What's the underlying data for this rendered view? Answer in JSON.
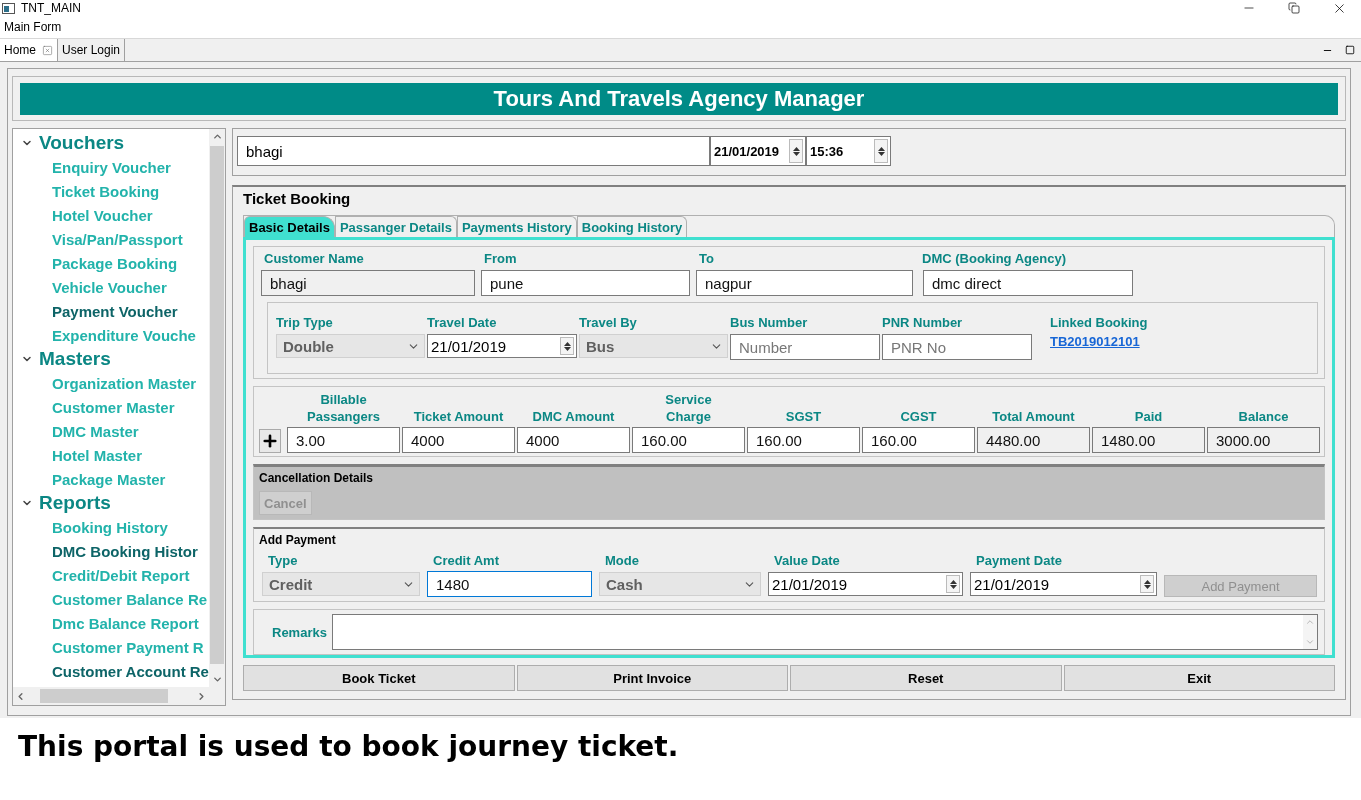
{
  "window": {
    "title": "TNT_MAIN"
  },
  "menu": [
    "Main Form"
  ],
  "doc_tabs": [
    {
      "label": "Home",
      "selected": true,
      "closable": true
    },
    {
      "label": "User Login",
      "selected": false,
      "closable": false
    }
  ],
  "header": {
    "title": "Tours And Travels Agency Manager"
  },
  "sidebar": {
    "groups": [
      {
        "label": "Vouchers",
        "expanded": true,
        "items": [
          {
            "label": "Enquiry Voucher",
            "highlighted": false
          },
          {
            "label": "Ticket Booking",
            "highlighted": false
          },
          {
            "label": "Hotel Voucher",
            "highlighted": false
          },
          {
            "label": "Visa/Pan/Passport",
            "highlighted": false
          },
          {
            "label": "Package Booking",
            "highlighted": false
          },
          {
            "label": "Vehicle Voucher",
            "highlighted": false
          },
          {
            "label": "Payment Voucher",
            "highlighted": true
          },
          {
            "label": "Expenditure Vouche",
            "highlighted": false
          }
        ]
      },
      {
        "label": "Masters",
        "expanded": true,
        "items": [
          {
            "label": "Organization Master",
            "highlighted": false
          },
          {
            "label": "Customer Master",
            "highlighted": false
          },
          {
            "label": "DMC Master",
            "highlighted": false
          },
          {
            "label": "Hotel Master",
            "highlighted": false
          },
          {
            "label": "Package Master",
            "highlighted": false
          }
        ]
      },
      {
        "label": "Reports",
        "expanded": true,
        "items": [
          {
            "label": "Booking History",
            "highlighted": false
          },
          {
            "label": "DMC Booking Histor",
            "highlighted": true
          },
          {
            "label": "Credit/Debit Report",
            "highlighted": false
          },
          {
            "label": "Customer Balance Re",
            "highlighted": false
          },
          {
            "label": "Dmc Balance Report",
            "highlighted": false
          },
          {
            "label": "Customer Payment R",
            "highlighted": false
          },
          {
            "label": "Customer Account Re",
            "highlighted": true
          }
        ]
      }
    ]
  },
  "top_bar": {
    "customer": "bhagi",
    "date": "21/01/2019",
    "time": "15:36"
  },
  "booking": {
    "title": "Ticket Booking",
    "tabs": [
      {
        "label": "Basic Details",
        "selected": true
      },
      {
        "label": "Passanger Details",
        "selected": false
      },
      {
        "label": "Payments History",
        "selected": false
      },
      {
        "label": "Booking History",
        "selected": false
      }
    ],
    "customer_fields": [
      {
        "label": "Customer Name",
        "value": "bhagi",
        "disabled": true
      },
      {
        "label": "From",
        "value": "pune",
        "disabled": false
      },
      {
        "label": "To",
        "value": "nagpur",
        "disabled": false
      },
      {
        "label": "DMC (Booking Agency)",
        "value": "dmc direct",
        "disabled": false
      }
    ],
    "trip_fields": [
      {
        "kind": "select",
        "label": "Trip Type",
        "value": "Double"
      },
      {
        "kind": "date",
        "label": "Travel Date",
        "value": "21/01/2019"
      },
      {
        "kind": "select",
        "label": "Travel By",
        "value": "Bus"
      },
      {
        "kind": "input",
        "label": "Bus Number",
        "placeholder": "Number"
      },
      {
        "kind": "input",
        "label": "PNR Number",
        "placeholder": "PNR No"
      },
      {
        "kind": "link",
        "label": "Linked Booking",
        "value": "TB2019012101"
      }
    ],
    "amounts": [
      {
        "label": "Billable Passangers",
        "value": "3.00",
        "readonly": false
      },
      {
        "label": "Ticket Amount",
        "value": "4000",
        "readonly": false
      },
      {
        "label": "DMC Amount",
        "value": "4000",
        "readonly": false
      },
      {
        "label": "Service Charge",
        "value": "160.00",
        "readonly": false
      },
      {
        "label": "SGST",
        "value": "160.00",
        "readonly": false
      },
      {
        "label": "CGST",
        "value": "160.00",
        "readonly": false
      },
      {
        "label": "Total Amount",
        "value": "4480.00",
        "readonly": true
      },
      {
        "label": "Paid",
        "value": "1480.00",
        "readonly": true
      },
      {
        "label": "Balance",
        "value": "3000.00",
        "readonly": true
      }
    ],
    "cancellation": {
      "title": "Cancellation Details",
      "button": {
        "label": "Cancel",
        "disabled": true
      }
    },
    "payment": {
      "title": "Add Payment",
      "fields": [
        {
          "kind": "select",
          "label": "Type",
          "value": "Credit",
          "focused": false
        },
        {
          "kind": "input",
          "label": "Credit Amt",
          "value": "1480",
          "focused": true
        },
        {
          "kind": "select",
          "label": "Mode",
          "value": "Cash",
          "focused": false
        },
        {
          "kind": "date",
          "label": "Value Date",
          "value": "21/01/2019",
          "focused": false
        },
        {
          "kind": "date",
          "label": "Payment Date",
          "value": "21/01/2019",
          "focused": false
        }
      ],
      "button": {
        "label": "Add Payment",
        "disabled": true
      }
    },
    "remarks": {
      "label": "Remarks"
    },
    "actions": [
      "Book Ticket",
      "Print Invoice",
      "Reset",
      "Exit"
    ]
  },
  "caption": "This portal is used to book journey ticket."
}
